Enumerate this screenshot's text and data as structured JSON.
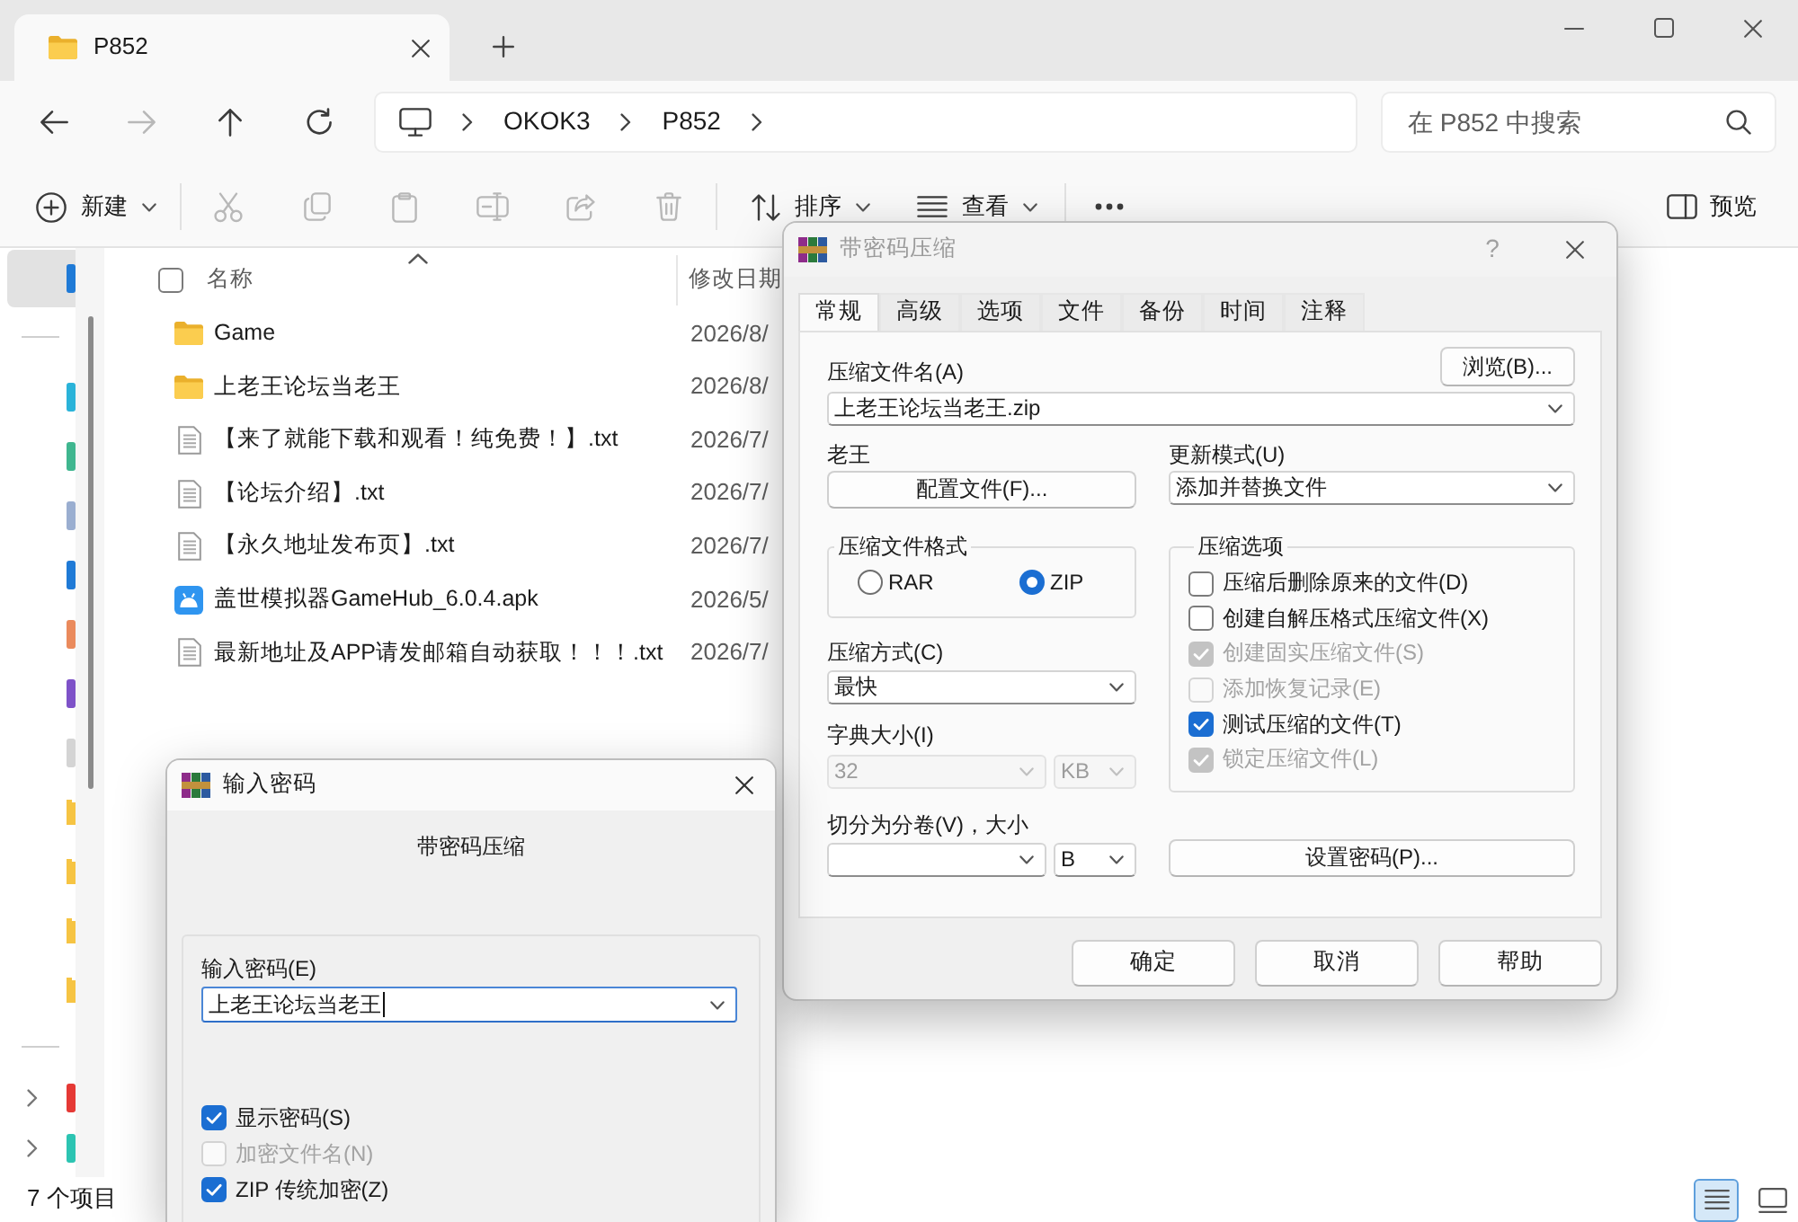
{
  "explorer": {
    "tab": {
      "title": "P852",
      "selected": true
    },
    "nav_buttons": [
      {
        "disabled": false
      },
      {
        "disabled": true
      },
      {
        "disabled": false
      },
      {
        "disabled": false
      }
    ],
    "address_path": [
      "OKOK3",
      "P852"
    ],
    "search": {
      "placeholder": "在 P852 中搜索"
    },
    "toolbar": {
      "new": "新建",
      "edit_actions": [
        {
          "disabled": true
        },
        {
          "disabled": true
        },
        {
          "disabled": true
        },
        {
          "disabled": true
        },
        {
          "disabled": true
        },
        {
          "disabled": true
        }
      ],
      "sort": "排序",
      "view": "查看",
      "preview": "预览"
    },
    "sidebar": {
      "home": {
        "selected": true,
        "color": "#1f7ad6"
      },
      "pinned": [
        {
          "kind": "app",
          "color": "#2ab3d9",
          "selected": false
        },
        {
          "kind": "app",
          "color": "#3fb68f",
          "selected": false
        },
        {
          "kind": "app",
          "color": "#9aaed0",
          "selected": false
        },
        {
          "kind": "app",
          "color": "#1f7ad6",
          "selected": false
        },
        {
          "kind": "app",
          "color": "#ea8a5c",
          "selected": false
        },
        {
          "kind": "app",
          "color": "#7e52c8",
          "selected": false
        },
        {
          "kind": "app",
          "color": "#d4d4d4",
          "selected": false
        },
        {
          "kind": "folder",
          "color": "#f6c443",
          "selected": false
        },
        {
          "kind": "folder",
          "color": "#f6c443",
          "selected": false
        },
        {
          "kind": "folder",
          "color": "#f6c443",
          "selected": false
        },
        {
          "kind": "folder",
          "color": "#f6c443",
          "selected": false
        }
      ],
      "sections": [
        {
          "expanded": false,
          "color": "#e53935"
        },
        {
          "expanded": false,
          "color": "#2cc4b2"
        }
      ]
    },
    "file_list": {
      "select_all": {
        "checked": false
      },
      "columns": [
        {
          "label": "名称",
          "sorted": true
        },
        {
          "label": "修改日期",
          "sorted": false
        }
      ],
      "rows": [
        {
          "kind": "folder",
          "name": "Game",
          "modified": "2026/8/"
        },
        {
          "kind": "folder",
          "name": "上老王论坛当老王",
          "modified": "2026/8/"
        },
        {
          "kind": "text",
          "name": "【来了就能下载和观看！纯免费！】.txt",
          "modified": "2026/7/"
        },
        {
          "kind": "text",
          "name": "【论坛介绍】.txt",
          "modified": "2026/7/"
        },
        {
          "kind": "text",
          "name": "【永久地址发布页】.txt",
          "modified": "2026/7/"
        },
        {
          "kind": "apk",
          "name": "盖世模拟器GameHub_6.0.4.apk",
          "modified": "2026/5/"
        },
        {
          "kind": "text",
          "name": "最新地址及APP请发邮箱自动获取！！！.txt",
          "modified": "2026/7/"
        }
      ]
    },
    "status_bar": {
      "item_count": "7 个项目",
      "views": [
        {
          "selected": true
        },
        {
          "selected": false
        }
      ]
    }
  },
  "compress_dialog": {
    "title": "带密码压缩",
    "active": false,
    "help_button": "?",
    "tabs": [
      {
        "label": "常规",
        "selected": true
      },
      {
        "label": "高级",
        "selected": false
      },
      {
        "label": "选项",
        "selected": false
      },
      {
        "label": "文件",
        "selected": false
      },
      {
        "label": "备份",
        "selected": false
      },
      {
        "label": "时间",
        "selected": false
      },
      {
        "label": "注释",
        "selected": false
      }
    ],
    "archive_name_label": "压缩文件名(A)",
    "browse_button": "浏览(B)...",
    "archive_name": "上老王论坛当老王.zip",
    "profile_label": "老王",
    "profile_button": "配置文件(F)...",
    "update_mode_label": "更新模式(U)",
    "update_mode": "添加并替换文件",
    "format_group": {
      "title": "压缩文件格式",
      "options": [
        {
          "label": "RAR",
          "selected": false
        },
        {
          "label": "ZIP",
          "selected": true
        }
      ]
    },
    "method_label": "压缩方式(C)",
    "method": "最快",
    "dictionary": {
      "label": "字典大小(I)",
      "size": "32",
      "unit": "KB",
      "disabled": true
    },
    "split": {
      "label": "切分为分卷(V)，大小",
      "unit": "B"
    },
    "options_group": {
      "title": "压缩选项",
      "items": [
        {
          "label": "压缩后删除原来的文件(D)",
          "checked": false,
          "disabled": false
        },
        {
          "label": "创建自解压格式压缩文件(X)",
          "checked": false,
          "disabled": false
        },
        {
          "label": "创建固实压缩文件(S)",
          "checked": true,
          "disabled": true
        },
        {
          "label": "添加恢复记录(E)",
          "checked": false,
          "disabled": true
        },
        {
          "label": "测试压缩的文件(T)",
          "checked": true,
          "disabled": false
        },
        {
          "label": "锁定压缩文件(L)",
          "checked": true,
          "disabled": true
        }
      ]
    },
    "password_button": "设置密码(P)...",
    "buttons": [
      "确定",
      "取消",
      "帮助"
    ]
  },
  "password_dialog": {
    "title": "输入密码",
    "active": true,
    "subtitle": "带密码压缩",
    "password_label": "输入密码(E)",
    "password": "上老王论坛当老王",
    "focused": true,
    "options": [
      {
        "label": "显示密码(S)",
        "checked": true,
        "disabled": false
      },
      {
        "label": "加密文件名(N)",
        "checked": false,
        "disabled": true
      },
      {
        "label": "ZIP 传统加密(Z)",
        "checked": true,
        "disabled": false
      }
    ]
  }
}
